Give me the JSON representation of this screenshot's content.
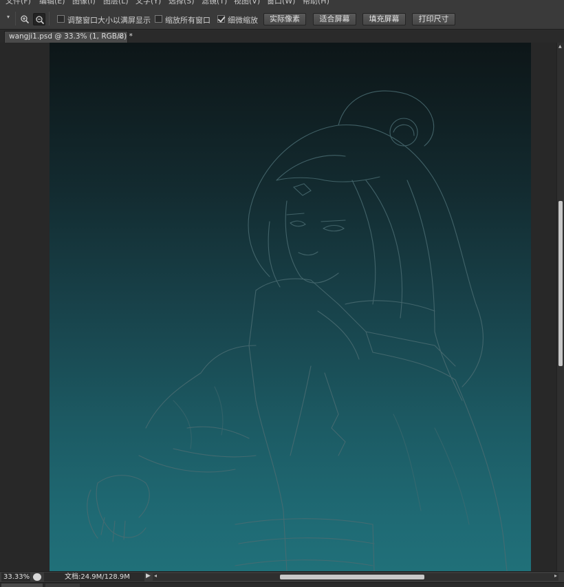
{
  "menubar": {
    "items": [
      "文件(F)",
      "编辑(E)",
      "图像(I)",
      "图层(L)",
      "文字(Y)",
      "选择(S)",
      "滤镜(T)",
      "视图(V)",
      "窗口(W)",
      "帮助(H)"
    ]
  },
  "options": {
    "resize_windows_label": "调整窗口大小以满屏显示",
    "resize_windows_checked": false,
    "zoom_all_windows_label": "缩放所有窗口",
    "zoom_all_windows_checked": false,
    "scrubby_zoom_label": "细微缩放",
    "scrubby_zoom_checked": true,
    "actual_pixels_label": "实际像素",
    "fit_screen_label": "适合屏幕",
    "fill_screen_label": "填充屏幕",
    "print_size_label": "打印尺寸"
  },
  "document_tab": {
    "title": "wangji1.psd @ 33.3% (1, RGB/8) *",
    "close_glyph": "×"
  },
  "canvas": {
    "gradient_top": "#0d1618",
    "gradient_bottom": "#207079",
    "sketch_color": "#4a6c72"
  },
  "status": {
    "zoom": "33.33%",
    "doc_info": "文档:24.9M/128.9M"
  },
  "icons": {
    "zoom_in": "zoom-in-icon",
    "zoom_out": "zoom-out-icon"
  }
}
